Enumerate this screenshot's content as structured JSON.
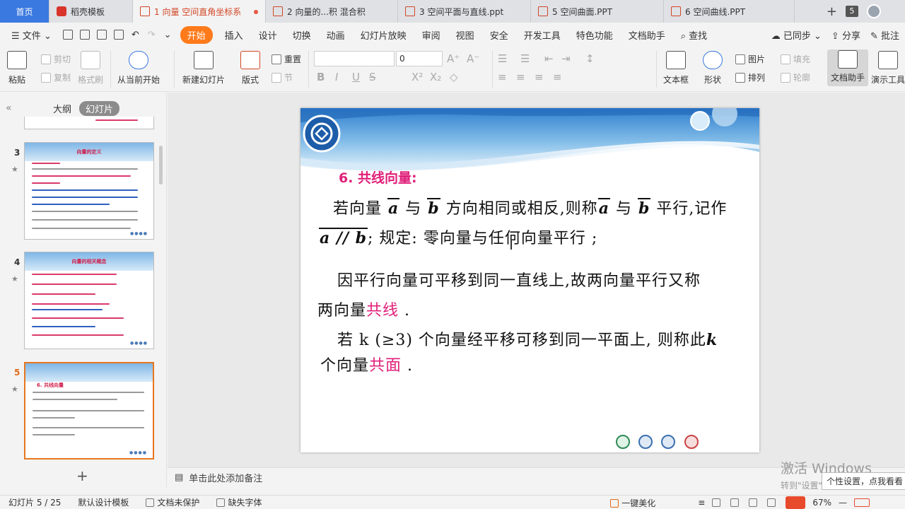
{
  "tabs": [
    {
      "label": "首页",
      "type": "home"
    },
    {
      "label": "稻壳模板",
      "type": "wps"
    },
    {
      "label": "1 向量 空间直角坐标系",
      "type": "ppt",
      "active": true,
      "modified": true
    },
    {
      "label": "2 向量的...积 混合积",
      "type": "ppt"
    },
    {
      "label": "3  空间平面与直线.ppt",
      "type": "ppt"
    },
    {
      "label": "5 空间曲面.PPT",
      "type": "ppt"
    },
    {
      "label": "6 空间曲线.PPT",
      "type": "ppt"
    }
  ],
  "tab_count": "5",
  "menu": {
    "file": "文件",
    "items": [
      "开始",
      "插入",
      "设计",
      "切换",
      "动画",
      "幻灯片放映",
      "审阅",
      "视图",
      "安全",
      "开发工具",
      "特色功能",
      "文档助手"
    ],
    "active": "开始",
    "search": "查找",
    "sync": "已同步",
    "share": "分享",
    "comment": "批注"
  },
  "ribbon": {
    "paste": "粘贴",
    "cut": "剪切",
    "copy": "复制",
    "format_painter": "格式刷",
    "from_current": "从当前开始",
    "new_slide": "新建幻灯片",
    "layout": "版式",
    "reset": "重置",
    "section": "节",
    "font_size": "0",
    "textbox": "文本框",
    "shape": "形状",
    "picture": "图片",
    "fill": "填充",
    "arrange": "排列",
    "outline": "轮廓",
    "doc_assistant": "文档助手",
    "present_tool": "演示工具"
  },
  "panel": {
    "outline_tab": "大纲",
    "slides_tab": "幻灯片",
    "thumbs": [
      {
        "num": "3",
        "title": "向量的定义"
      },
      {
        "num": "4",
        "title": "向量的相关概念"
      },
      {
        "num": "5",
        "title": "6. 共线向量",
        "active": true
      }
    ]
  },
  "slide": {
    "title": "6. 共线向量:",
    "p1a": "若向量",
    "vec_a": "a",
    "p1b": "与",
    "vec_b": "b",
    "p1c": "方向相同或相反,则称",
    "p1d": "与",
    "p1e": "平行,记作",
    "p2a": "a // b",
    "p2b": "; 规定: 零向量与任何向量平行 ;",
    "p3a": "因平行向量可平移到同一直线上,故两向量平行又称",
    "p3b": "两向量",
    "p3c": "共线",
    "p3d": " .",
    "p4a": "若",
    "p4b": "k (≥3) 个向量经平移可移到同一平面上, 则称此",
    "p4c": "k",
    "p5a": "个向量",
    "p5b": "共面",
    "p5c": " ."
  },
  "notes_placeholder": "单击此处添加备注",
  "watermark": {
    "line1": "激活 Windows",
    "line2": "转到\"设置\"以激活 Windows。"
  },
  "tooltip": "个性设置，点我看看",
  "status": {
    "slide_pos": "幻灯片 5 / 25",
    "template": "默认设计模板",
    "protect": "文档未保护",
    "missing_font": "缺失字体",
    "beautify": "一键美化",
    "zoom": "67%"
  },
  "colors": {
    "accent": "#ff7a1a",
    "title_pink": "#e0207a",
    "home_tab": "#3a79e0"
  }
}
